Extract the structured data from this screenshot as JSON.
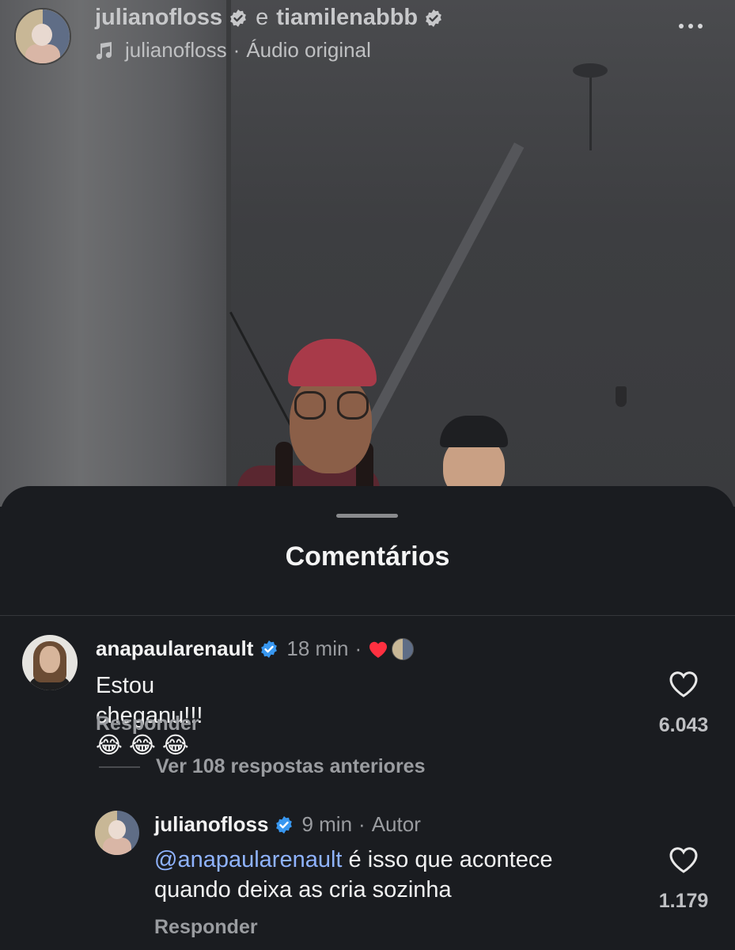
{
  "reel": {
    "author_primary": "julianofloss",
    "conjunction": "e",
    "author_secondary": "tiamilenabbb",
    "audio_author": "julianofloss",
    "audio_separator": "·",
    "audio_label": "Áudio original"
  },
  "sheet": {
    "title": "Comentários"
  },
  "comments": [
    {
      "username": "anapaularenault",
      "time": "18 min",
      "separator": "·",
      "text": "Estou cheganu!!!😂 😂 😂",
      "reply_label": "Responder",
      "like_count": "6.043"
    }
  ],
  "view_replies_label": "Ver 108 respostas anteriores",
  "replies": [
    {
      "username": "julianofloss",
      "time": "9 min",
      "separator": "·",
      "role": "Autor",
      "mention": "@anapaularenault",
      "text_line1": " é isso que acontece",
      "text_line2": "quando deixa as cria sozinha",
      "reply_label": "Responder",
      "like_count": "1.179"
    }
  ],
  "colors": {
    "sheet_bg": "#1a1c20",
    "mention": "#8fb3ff",
    "verified": "#3897f0",
    "heart": "#ff3040"
  }
}
